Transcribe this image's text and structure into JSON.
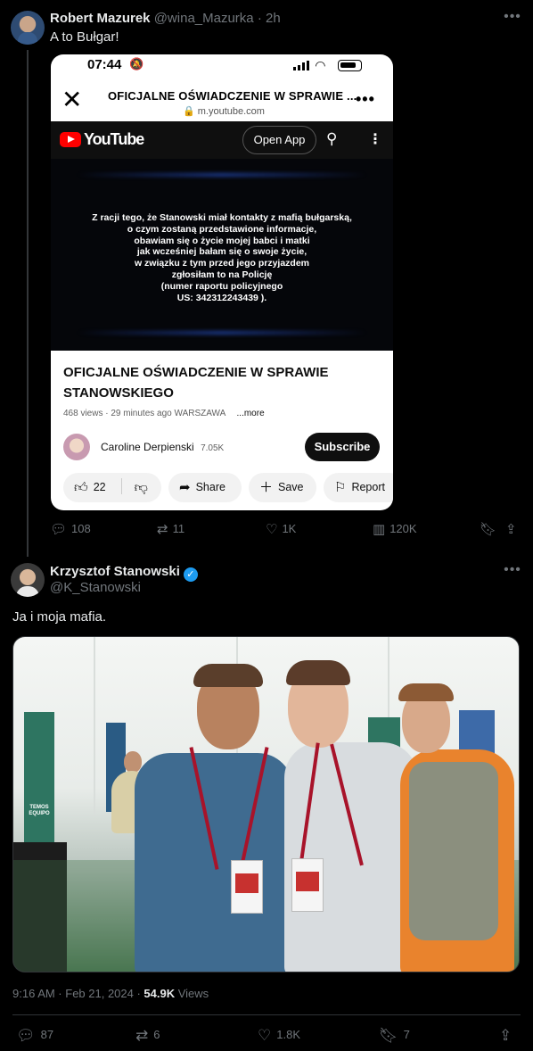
{
  "tweet1": {
    "author_name": "Robert Mazurek",
    "author_handle": "@wina_Mazurka",
    "separator": "·",
    "time_ago": "2h",
    "text": "A to Bułgar!",
    "stats": {
      "replies": "108",
      "reposts": "11",
      "likes": "1K",
      "views": "120K"
    }
  },
  "phone": {
    "status_time": "07:44",
    "page_title": "OFICJALNE OŚWIADCZENIE W SPRAWIE ...",
    "url": "m.youtube.com",
    "yt_wordmark": "YouTube",
    "open_app_label": "Open App",
    "video_text": [
      "Z racji tego, że Stanowski miał kontakty z mafią bułgarską,",
      "o czym zostaną przedstawione informacje,",
      "obawiam się o życie mojej babci i matki",
      "jak wcześniej bałam się o swoje życie,",
      "w związku z tym przed jego przyjazdem",
      "zgłosiłam to na Policję",
      "(numer raportu policyjnego",
      "US: 342312243439 )."
    ],
    "video_title": "OFICJALNE OŚWIADCZENIE W SPRAWIE STANOWSKIEGO",
    "video_meta": "468 views · 29 minutes ago WARSZAWA",
    "more_label": "...more",
    "channel_name": "Caroline Derpienski",
    "channel_subs": "7.05K",
    "subscribe_label": "Subscribe",
    "likes": "22",
    "share_label": "Share",
    "save_label": "Save",
    "report_label": "Report"
  },
  "tweet2": {
    "author_name": "Krzysztof Stanowski",
    "author_handle": "@K_Stanowski",
    "text": "Ja i moja mafia.",
    "timestamp": "9:16 AM · Feb 21, 2024 · ",
    "views_count": "54.9K",
    "views_label": " Views",
    "stats": {
      "replies": "87",
      "reposts": "6",
      "likes": "1.8K",
      "bookmarks": "7"
    },
    "photo_banner_text": "TEMOS EQUIPO"
  },
  "icons": {
    "more": "more-horizontal-icon",
    "reply": "reply-icon",
    "repost": "repost-icon",
    "like": "heart-icon",
    "views": "analytics-icon",
    "bookmark": "bookmark-icon",
    "share": "share-icon",
    "verified": "verified-badge-icon"
  },
  "colors": {
    "background": "#000000",
    "text": "#e7e9ea",
    "muted": "#71767b",
    "verified": "#1d9bf0",
    "youtube_red": "#ff0000"
  }
}
